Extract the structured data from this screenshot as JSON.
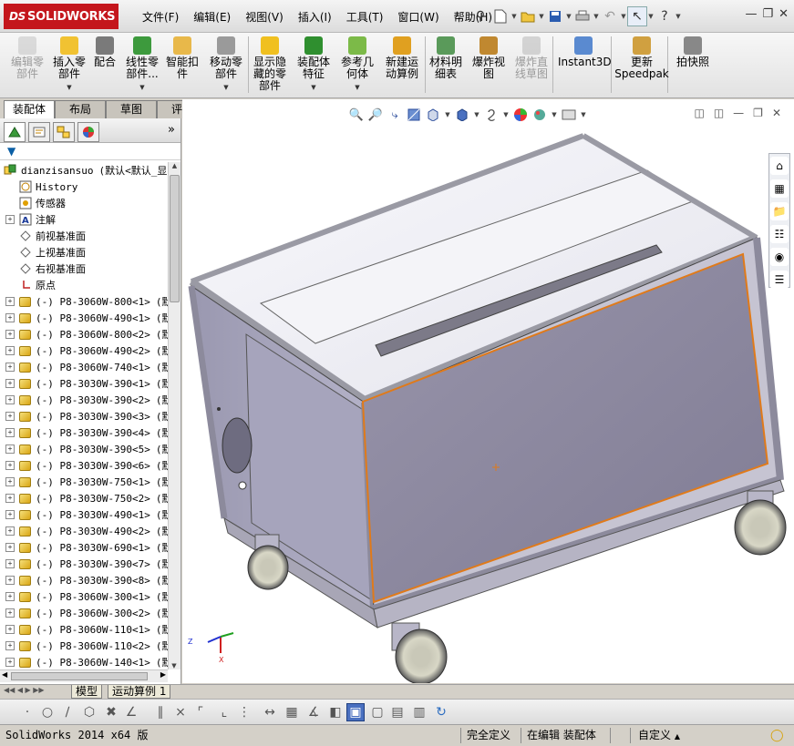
{
  "app": {
    "title": "SOLIDWORKS",
    "logo_prefix": "DS"
  },
  "menu": [
    "文件(F)",
    "编辑(E)",
    "视图(V)",
    "插入(I)",
    "工具(T)",
    "窗口(W)",
    "帮助(H)"
  ],
  "commands": [
    {
      "label": "编辑零\n部件",
      "disabled": true,
      "icon": "edit-component-icon"
    },
    {
      "label": "插入零\n部件",
      "disabled": false,
      "icon": "insert-components-icon",
      "dropdown": true
    },
    {
      "label": "配合",
      "disabled": false,
      "icon": "mate-icon"
    },
    {
      "label": "线性零\n部件...",
      "disabled": false,
      "icon": "linear-pattern-icon",
      "dropdown": true
    },
    {
      "label": "智能扣\n件",
      "disabled": false,
      "icon": "smart-fasteners-icon"
    },
    {
      "label": "移动零\n部件",
      "disabled": false,
      "icon": "move-component-icon",
      "dropdown": true
    },
    {
      "label": "显示隐\n藏的零\n部件",
      "disabled": false,
      "icon": "show-hidden-components-icon"
    },
    {
      "label": "装配体\n特征",
      "disabled": false,
      "icon": "assembly-features-icon",
      "dropdown": true
    },
    {
      "label": "参考几\n何体",
      "disabled": false,
      "icon": "reference-geometry-icon",
      "dropdown": true
    },
    {
      "label": "新建运\n动算例",
      "disabled": false,
      "icon": "new-motion-study-icon"
    },
    {
      "label": "材料明\n细表",
      "disabled": false,
      "icon": "bill-of-materials-icon"
    },
    {
      "label": "爆炸视\n图",
      "disabled": false,
      "icon": "exploded-view-icon"
    },
    {
      "label": "爆炸直\n线草图",
      "disabled": true,
      "icon": "explode-line-sketch-icon"
    },
    {
      "label": "Instant3D",
      "disabled": false,
      "icon": "instant3d-icon"
    },
    {
      "label": "更新\nSpeedpak",
      "disabled": false,
      "icon": "update-speedpak-icon"
    },
    {
      "label": "拍快照",
      "disabled": false,
      "icon": "take-snapshot-icon"
    }
  ],
  "cm_tabs": [
    "装配体",
    "布局",
    "草图",
    "评估"
  ],
  "tree": {
    "root": {
      "name": "dianzisansuo",
      "config": "(默认<默认_显"
    },
    "items": [
      {
        "label": "History",
        "icon": "history-icon",
        "expand": false
      },
      {
        "label": "传感器",
        "icon": "sensors-icon",
        "expand": false
      },
      {
        "label": "注解",
        "icon": "annotations-icon",
        "expand": true
      },
      {
        "label": "前视基准面",
        "icon": "plane-icon",
        "expand": false
      },
      {
        "label": "上视基准面",
        "icon": "plane-icon",
        "expand": false
      },
      {
        "label": "右视基准面",
        "icon": "plane-icon",
        "expand": false
      },
      {
        "label": "原点",
        "icon": "origin-icon",
        "expand": false
      }
    ],
    "parts": [
      "(-) P8-3060W-800<1>",
      "(-) P8-3060W-490<1>",
      "(-) P8-3060W-800<2>",
      "(-) P8-3060W-490<2>",
      "(-) P8-3060W-740<1>",
      "(-) P8-3030W-390<1>",
      "(-) P8-3030W-390<2>",
      "(-) P8-3030W-390<3>",
      "(-) P8-3030W-390<4>",
      "(-) P8-3030W-390<5>",
      "(-) P8-3030W-390<6>",
      "(-) P8-3030W-750<1>",
      "(-) P8-3030W-750<2>",
      "(-) P8-3030W-490<1>",
      "(-) P8-3030W-490<2>",
      "(-) P8-3030W-690<1>",
      "(-) P8-3030W-390<7>",
      "(-) P8-3030W-390<8>",
      "(-) P8-3060W-300<1>",
      "(-) P8-3060W-300<2>",
      "(-) P8-3060W-110<1>",
      "(-) P8-3060W-110<2>",
      "(-) P8-3060W-140<1>"
    ],
    "part_config": "(默"
  },
  "model_tabs": [
    "模型",
    "运动算例 1"
  ],
  "status": {
    "version": "SolidWorks 2014 x64 版",
    "defined": "完全定义",
    "editing": "在编辑 装配体",
    "units": "自定义"
  },
  "colors": {
    "accent_red": "#c4161c",
    "panel_face": "#8e8aa0",
    "highlight_edge": "#e07a1a"
  }
}
